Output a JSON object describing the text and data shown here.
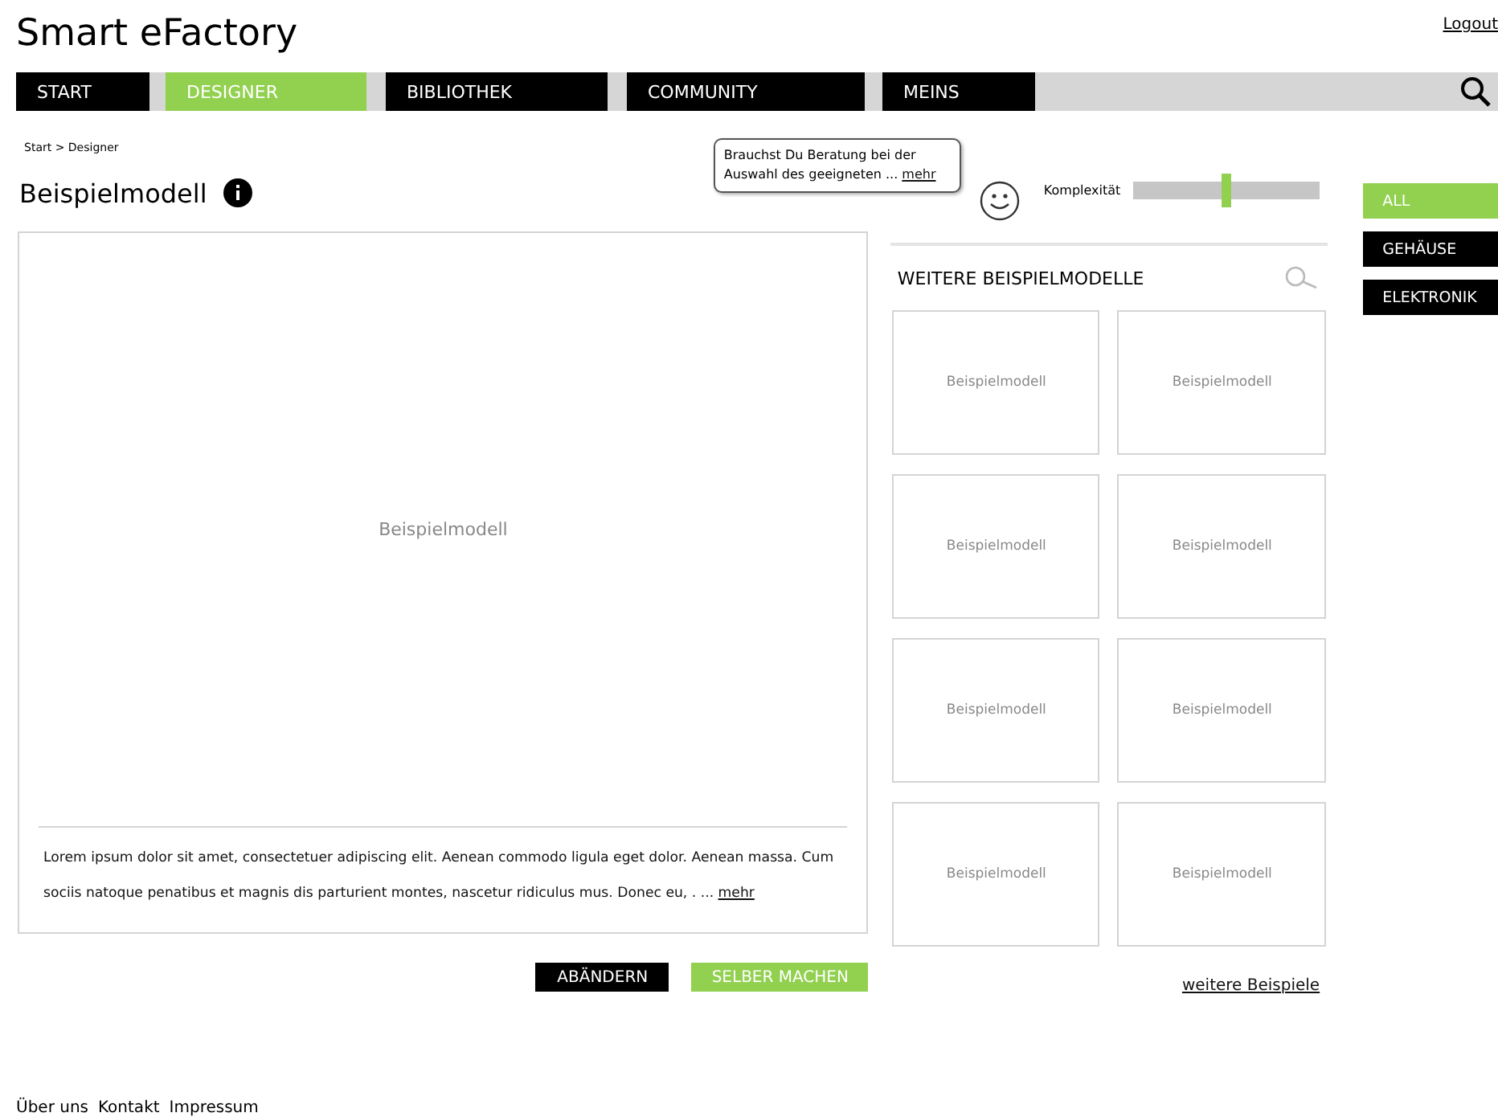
{
  "header": {
    "title": "Smart eFactory",
    "logout": "Logout"
  },
  "nav": {
    "tabs": [
      {
        "label": "START",
        "selected": false
      },
      {
        "label": "DESIGNER",
        "selected": true
      },
      {
        "label": "BIBLIOTHEK",
        "selected": false
      },
      {
        "label": "COMMUNITY",
        "selected": false
      },
      {
        "label": "MEINS",
        "selected": false
      }
    ]
  },
  "breadcrumb": "Start > Designer",
  "page_title": "Beispielmodell",
  "tooltip": {
    "text": "Brauchst Du Beratung bei der Auswahl des geeigneten ...",
    "link": "mehr"
  },
  "complexity": {
    "label": "Komplexität",
    "level": 0.5
  },
  "filters": [
    {
      "label": "ALL",
      "selected": true
    },
    {
      "label": "GEHÄUSE",
      "selected": false
    },
    {
      "label": "ELEKTRONIK",
      "selected": false
    }
  ],
  "main_model": {
    "label": "Beispielmodell",
    "description": "Lorem ipsum dolor sit amet, consectetuer adipiscing elit. Aenean commodo ligula eget dolor. Aenean massa. Cum sociis natoque penatibus et magnis dis parturient montes, nascetur ridiculus mus. Donec eu, . ...",
    "link": "mehr"
  },
  "more_models": {
    "heading": "WEITERE BEISPIELMODELLE",
    "tiles": [
      "Beispielmodell",
      "Beispielmodell",
      "Beispielmodell",
      "Beispielmodell",
      "Beispielmodell",
      "Beispielmodell",
      "Beispielmodell",
      "Beispielmodell"
    ],
    "more_link": "weitere Beispiele"
  },
  "buttons": [
    {
      "label": "ABÄNDERN",
      "kind": "dark"
    },
    {
      "label": "SELBER MACHEN",
      "kind": "accent"
    }
  ],
  "footer": [
    "Über uns",
    "Kontakt",
    "Impressum"
  ]
}
